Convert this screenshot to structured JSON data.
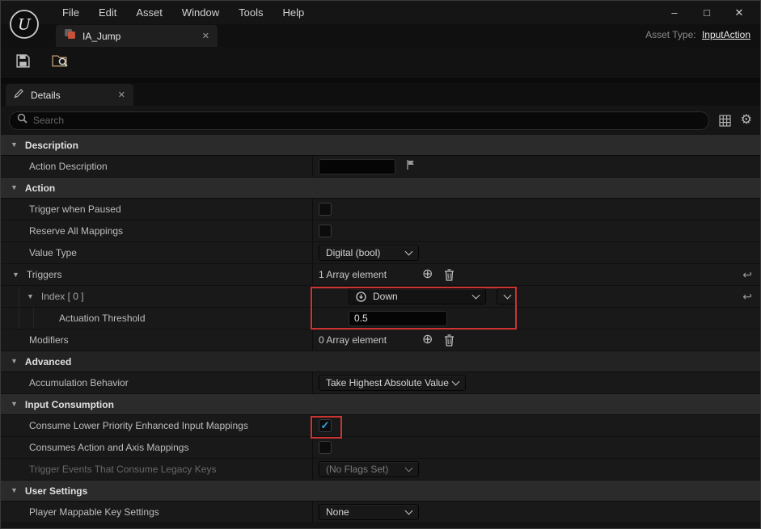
{
  "titlebar": {
    "menus": [
      "File",
      "Edit",
      "Asset",
      "Window",
      "Tools",
      "Help"
    ]
  },
  "tabbar": {
    "tab_label": "IA_Jump",
    "asset_type_label": "Asset Type:",
    "asset_type_value": "InputAction"
  },
  "details": {
    "tab_label": "Details",
    "search_placeholder": "Search"
  },
  "properties": {
    "description_section": "Description",
    "action_description_label": "Action Description",
    "action_description_value": "",
    "action_section": "Action",
    "trigger_when_paused_label": "Trigger when Paused",
    "trigger_when_paused_checked": false,
    "reserve_all_mappings_label": "Reserve All Mappings",
    "reserve_all_mappings_checked": false,
    "value_type_label": "Value Type",
    "value_type_value": "Digital (bool)",
    "triggers_label": "Triggers",
    "triggers_count": "1 Array element",
    "index0_label": "Index [ 0 ]",
    "index0_value": "Down",
    "actuation_threshold_label": "Actuation Threshold",
    "actuation_threshold_value": "0.5",
    "modifiers_label": "Modifiers",
    "modifiers_count": "0 Array element",
    "advanced_section": "Advanced",
    "accumulation_behavior_label": "Accumulation Behavior",
    "accumulation_behavior_value": "Take Highest Absolute Value",
    "input_consumption_section": "Input Consumption",
    "consume_lower_label": "Consume Lower Priority Enhanced Input Mappings",
    "consume_lower_checked": true,
    "consumes_action_axis_label": "Consumes Action and Axis Mappings",
    "consumes_action_axis_checked": false,
    "trigger_events_label": "Trigger Events That Consume Legacy Keys",
    "trigger_events_value": "(No Flags Set)",
    "user_settings_section": "User Settings",
    "player_mappable_label": "Player Mappable Key Settings",
    "player_mappable_value": "None"
  }
}
